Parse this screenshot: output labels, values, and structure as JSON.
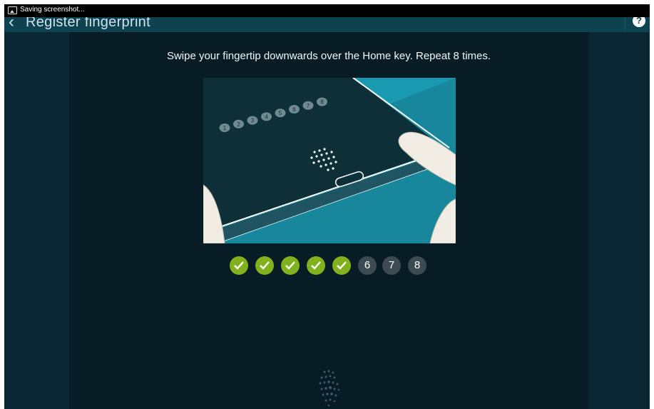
{
  "status_bar": {
    "notification": "Saving screenshot..."
  },
  "action_bar": {
    "title": "Register fingerprint"
  },
  "main": {
    "instruction": "Swipe your fingertip downwards over the Home key. Repeat 8 times.",
    "illustration": {
      "badges": [
        "1",
        "2",
        "3",
        "4",
        "5",
        "6",
        "7",
        "8"
      ]
    },
    "progress": {
      "completed": 5,
      "total": 8,
      "remaining_labels": [
        "6",
        "7",
        "8"
      ],
      "done_color": "#7fb21d",
      "todo_color": "#3c4b52"
    }
  },
  "icons": {
    "status": "image-icon",
    "back": "chevron-left-icon",
    "help": "help-icon",
    "check": "check-icon",
    "fingerprint": "fingerprint-icon"
  },
  "colors": {
    "background": "#0a2530",
    "action_bar": "#0d4250",
    "accent": "#1b8fa3"
  }
}
